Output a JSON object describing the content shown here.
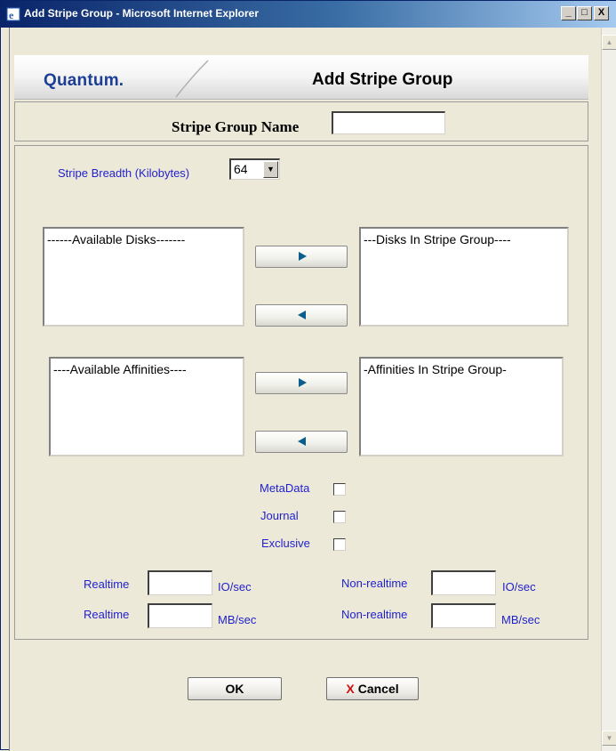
{
  "window": {
    "title": "Add Stripe Group - Microsoft Internet Explorer",
    "minimize": "_",
    "maximize": "□",
    "close": "X"
  },
  "header": {
    "logo": "Quantum.",
    "title": "Add Stripe Group"
  },
  "name_field": {
    "label": "Stripe Group Name",
    "value": ""
  },
  "stripe_breadth": {
    "label": "Stripe Breadth (Kilobytes)",
    "selected": "64"
  },
  "disks": {
    "available_header": "------Available Disks-------",
    "in_group_header": "---Disks In Stripe Group----"
  },
  "affinities": {
    "available_header": "----Available Affinities----",
    "in_group_header": "-Affinities In Stripe Group-"
  },
  "checkboxes": {
    "metadata": "MetaData",
    "journal": "Journal",
    "exclusive": "Exclusive"
  },
  "rates": {
    "realtime_label": "Realtime",
    "nonrealtime_label": "Non-realtime",
    "io_unit": "IO/sec",
    "mb_unit": "MB/sec"
  },
  "buttons": {
    "ok": "OK",
    "cancel_icon": "X",
    "cancel": "Cancel"
  },
  "colors": {
    "label_blue": "#1f1fcf",
    "logo_blue": "#1c3f94",
    "titlebar": "#0a246a",
    "arrow_teal": "#0b5e8c"
  }
}
